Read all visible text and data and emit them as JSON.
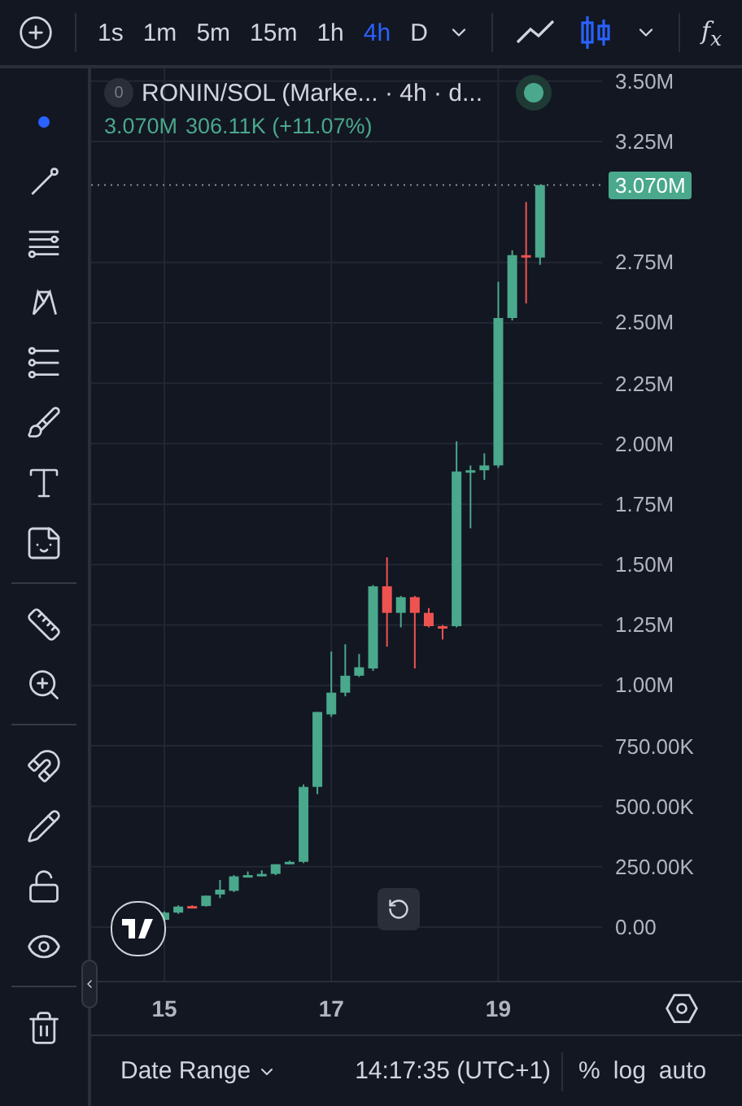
{
  "toolbar": {
    "intervals": [
      {
        "label": "1s",
        "selected": false
      },
      {
        "label": "1m",
        "selected": false
      },
      {
        "label": "5m",
        "selected": false
      },
      {
        "label": "15m",
        "selected": false
      },
      {
        "label": "1h",
        "selected": false
      },
      {
        "label": "4h",
        "selected": true
      },
      {
        "label": "D",
        "selected": false
      }
    ],
    "chart_styles": [
      {
        "kind": "line",
        "selected": false
      },
      {
        "kind": "candles",
        "selected": true
      }
    ],
    "indicators_label": "f$_{x}$"
  },
  "last_price": "3.070M",
  "legend": {
    "badge": "0",
    "title": "RONIN/SOL (Marke... · 4h · d...",
    "close": "3.070M",
    "change": "306.11K (+11.07%)"
  },
  "chart": {
    "chart_data": {
      "type": "candlestick",
      "x": [
        15,
        15.167,
        15.333,
        15.5,
        15.667,
        15.833,
        16,
        16.167,
        16.333,
        16.5,
        16.667,
        16.833,
        17,
        17.167,
        17.333,
        17.5,
        17.667,
        17.833,
        18,
        18.167,
        18.333,
        18.5,
        18.667,
        18.833,
        19,
        19.167,
        19.333,
        19.5
      ],
      "ohlc": [
        [
          30000,
          65000,
          25000,
          60000
        ],
        [
          60000,
          90000,
          55000,
          85000
        ],
        [
          87000,
          90000,
          78000,
          83000
        ],
        [
          87000,
          130000,
          85000,
          130000
        ],
        [
          135000,
          195000,
          120000,
          155000
        ],
        [
          150000,
          215000,
          145000,
          210000
        ],
        [
          210000,
          230000,
          205000,
          215000
        ],
        [
          215000,
          235000,
          210000,
          220000
        ],
        [
          220000,
          260000,
          215000,
          260000
        ],
        [
          265000,
          275000,
          260000,
          270000
        ],
        [
          270000,
          590000,
          265000,
          580000
        ],
        [
          580000,
          890000,
          550000,
          890000
        ],
        [
          880000,
          1140000,
          870000,
          970000
        ],
        [
          970000,
          1170000,
          955000,
          1040000
        ],
        [
          1040000,
          1130000,
          1035000,
          1075000
        ],
        [
          1070000,
          1415000,
          1060000,
          1410000
        ],
        [
          1410000,
          1530000,
          1160000,
          1300000
        ],
        [
          1300000,
          1370000,
          1240000,
          1365000
        ],
        [
          1365000,
          1370000,
          1070000,
          1300000
        ],
        [
          1300000,
          1320000,
          1240000,
          1245000
        ],
        [
          1245000,
          1250000,
          1190000,
          1240000
        ],
        [
          1245000,
          2010000,
          1240000,
          1885000
        ],
        [
          1885000,
          1910000,
          1650000,
          1890000
        ],
        [
          1890000,
          1960000,
          1850000,
          1910000
        ],
        [
          1910000,
          2670000,
          1900000,
          2520000
        ],
        [
          2520000,
          2800000,
          2510000,
          2780000
        ],
        [
          2780000,
          3000000,
          2580000,
          2770000
        ],
        [
          2770000,
          3070000,
          2740000,
          3070000
        ]
      ],
      "xlim": [
        14.123,
        21.88
      ],
      "ylim": [
        -740139,
        3835625
      ],
      "grid": true,
      "xticks": [
        {
          "value": 15,
          "label": "15"
        },
        {
          "value": 17,
          "label": "17"
        },
        {
          "value": 19,
          "label": "19"
        }
      ],
      "yticks": [
        {
          "value": 0,
          "label": "0.00"
        },
        {
          "value": 250000,
          "label": "250.00K"
        },
        {
          "value": 500000,
          "label": "500.00K"
        },
        {
          "value": 750000,
          "label": "750.00K"
        },
        {
          "value": 1000000,
          "label": "1.00M"
        },
        {
          "value": 1250000,
          "label": "1.25M"
        },
        {
          "value": 1500000,
          "label": "1.50M"
        },
        {
          "value": 1750000,
          "label": "1.75M"
        },
        {
          "value": 2000000,
          "label": "2.00M"
        },
        {
          "value": 2250000,
          "label": "2.25M"
        },
        {
          "value": 2500000,
          "label": "2.50M"
        },
        {
          "value": 2750000,
          "label": "2.75M"
        },
        {
          "value": 3250000,
          "label": "3.25M"
        },
        {
          "value": 3500000,
          "label": "3.50M"
        }
      ]
    }
  },
  "bottom_bar": {
    "date_range": "Date Range",
    "time": "14:17:35 (UTC+1)",
    "options": [
      "%",
      "log",
      "auto"
    ]
  }
}
